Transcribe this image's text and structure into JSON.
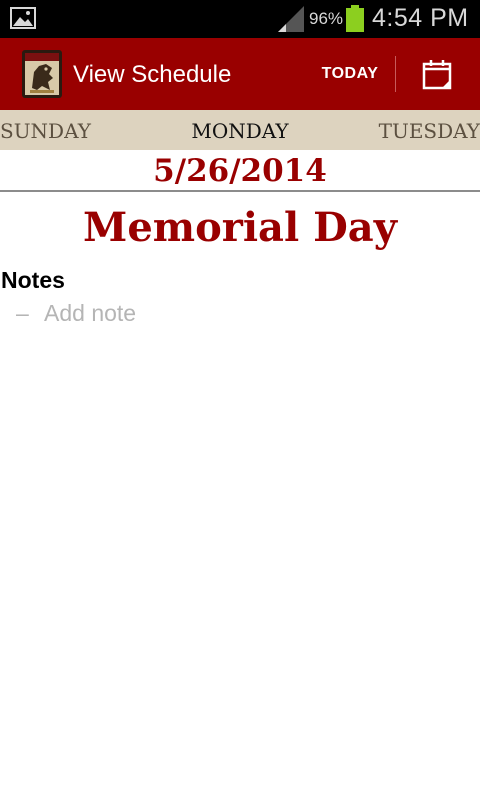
{
  "status_bar": {
    "battery_percent": "96%",
    "time": "4:54 PM",
    "notification_icon": "image-icon",
    "battery_color": "#8ccf1f"
  },
  "action_bar": {
    "title": "View Schedule",
    "today_label": "TODAY",
    "app_icon": "heraldic-lion-icon",
    "calendar_icon": "calendar-icon",
    "background": "#990000"
  },
  "day_strip": {
    "previous": "SUNDAY",
    "current": "MONDAY",
    "next": "TUESDAY"
  },
  "date": "5/26/2014",
  "feast": "Memorial Day",
  "notes": {
    "heading": "Notes",
    "dash": "–",
    "add_note_placeholder": "Add note"
  }
}
